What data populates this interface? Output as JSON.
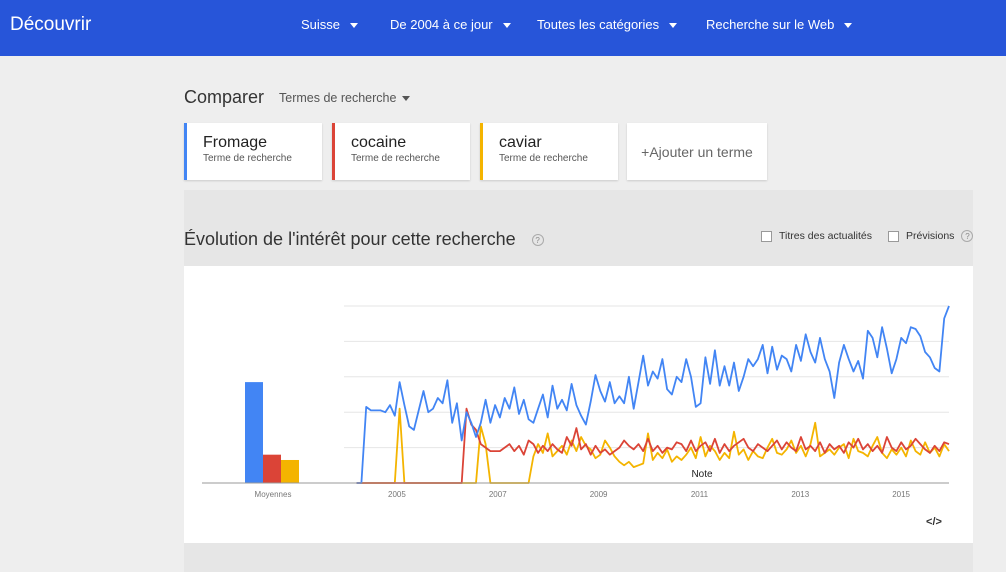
{
  "header": {
    "brand": "Découvrir",
    "nav": [
      "Suisse",
      "De 2004 à ce jour",
      "Toutes les catégories",
      "Recherche sur le Web"
    ]
  },
  "compare": {
    "title": "Comparer",
    "selector": "Termes de recherche",
    "terms": [
      {
        "name": "Fromage",
        "sub": "Terme de recherche",
        "color": "#4285f4"
      },
      {
        "name": "cocaine",
        "sub": "Terme de recherche",
        "color": "#db4437"
      },
      {
        "name": "caviar",
        "sub": "Terme de recherche",
        "color": "#f4b400"
      }
    ],
    "add_label": "+Ajouter un terme"
  },
  "interest": {
    "title": "Évolution de l'intérêt pour cette recherche",
    "help": "?",
    "news_label": "Titres des actualités",
    "forecast_label": "Prévisions",
    "embed_label": "</>",
    "note_label": "Note"
  },
  "chart_data": {
    "type": "line",
    "xlabel": "",
    "ylabel": "",
    "x_ticks": [
      "2005",
      "2007",
      "2009",
      "2011",
      "2013",
      "2015"
    ],
    "x_range": [
      2004.0,
      2016.0
    ],
    "y_range": [
      0,
      100
    ],
    "grid": true,
    "averages_label": "Moyennes",
    "averages": [
      {
        "term": "Fromage",
        "value": 57,
        "color": "#4285f4"
      },
      {
        "term": "cocaine",
        "value": 16,
        "color": "#db4437"
      },
      {
        "term": "caviar",
        "value": 13,
        "color": "#f4b400"
      }
    ],
    "series": [
      {
        "name": "Fromage",
        "color": "#4285f4",
        "x_start": 2004.25,
        "x_end": 2016.0,
        "values": [
          0,
          0,
          43,
          41,
          41,
          41,
          40,
          44,
          38,
          57,
          44,
          32,
          30,
          41,
          52,
          40,
          42,
          48,
          45,
          58,
          34,
          45,
          24,
          40,
          34,
          26,
          34,
          47,
          34,
          44,
          37,
          48,
          42,
          54,
          39,
          47,
          36,
          34,
          42,
          50,
          37,
          55,
          42,
          47,
          41,
          56,
          44,
          38,
          33,
          46,
          61,
          52,
          46,
          57,
          45,
          49,
          45,
          60,
          42,
          57,
          72,
          55,
          63,
          59,
          70,
          53,
          50,
          60,
          57,
          70,
          60,
          43,
          45,
          71,
          56,
          75,
          55,
          66,
          55,
          68,
          52,
          60,
          70,
          66,
          70,
          78,
          62,
          77,
          64,
          72,
          70,
          63,
          78,
          69,
          84,
          74,
          68,
          82,
          70,
          63,
          48,
          68,
          78,
          70,
          63,
          69,
          59,
          86,
          82,
          71,
          88,
          76,
          62,
          70,
          82,
          79,
          88,
          87,
          83,
          74,
          71,
          65,
          63,
          93,
          100
        ]
      },
      {
        "name": "cocaine",
        "color": "#db4437",
        "x_start": 2004.25,
        "x_end": 2016.0,
        "values": [
          0,
          0,
          0,
          0,
          0,
          0,
          0,
          0,
          0,
          0,
          0,
          0,
          0,
          0,
          0,
          0,
          0,
          0,
          0,
          0,
          0,
          0,
          0,
          42,
          33,
          30,
          22,
          20,
          18,
          18,
          18,
          20,
          22,
          18,
          21,
          16,
          24,
          22,
          17,
          21,
          18,
          22,
          19,
          17,
          26,
          21,
          31,
          19,
          22,
          16,
          21,
          17,
          19,
          16,
          18,
          20,
          24,
          21,
          19,
          22,
          18,
          25,
          18,
          21,
          17,
          20,
          19,
          23,
          22,
          18,
          24,
          18,
          21,
          23,
          18,
          25,
          17,
          22,
          18,
          21,
          23,
          25,
          20,
          18,
          22,
          20,
          18,
          21,
          24,
          19,
          23,
          20,
          18,
          26,
          19,
          21,
          18,
          23,
          17,
          22,
          19,
          21,
          17,
          23,
          20,
          25,
          19,
          22,
          18,
          21,
          17,
          26,
          20,
          18,
          23,
          19,
          21,
          25,
          22,
          19,
          17,
          21,
          18,
          23,
          22
        ]
      },
      {
        "name": "caviar",
        "color": "#f4b400",
        "x_start": 2004.25,
        "x_end": 2016.0,
        "values": [
          0,
          0,
          0,
          0,
          0,
          0,
          0,
          0,
          0,
          42,
          0,
          0,
          0,
          0,
          0,
          0,
          0,
          0,
          0,
          0,
          0,
          0,
          0,
          0,
          0,
          0,
          32,
          22,
          0,
          0,
          0,
          0,
          0,
          0,
          0,
          0,
          0,
          15,
          22,
          17,
          28,
          15,
          18,
          21,
          16,
          24,
          18,
          26,
          21,
          19,
          14,
          16,
          24,
          20,
          15,
          12,
          10,
          12,
          9,
          10,
          11,
          28,
          13,
          17,
          14,
          19,
          12,
          15,
          13,
          16,
          20,
          14,
          26,
          15,
          21,
          18,
          13,
          17,
          14,
          29,
          16,
          19,
          13,
          18,
          15,
          14,
          20,
          25,
          17,
          16,
          19,
          24,
          17,
          21,
          15,
          22,
          34,
          15,
          17,
          19,
          16,
          20,
          22,
          14,
          25,
          18,
          17,
          15,
          21,
          26,
          17,
          14,
          19,
          16,
          20,
          15,
          24,
          18,
          16,
          23,
          17,
          20,
          15,
          22,
          18
        ]
      }
    ]
  }
}
